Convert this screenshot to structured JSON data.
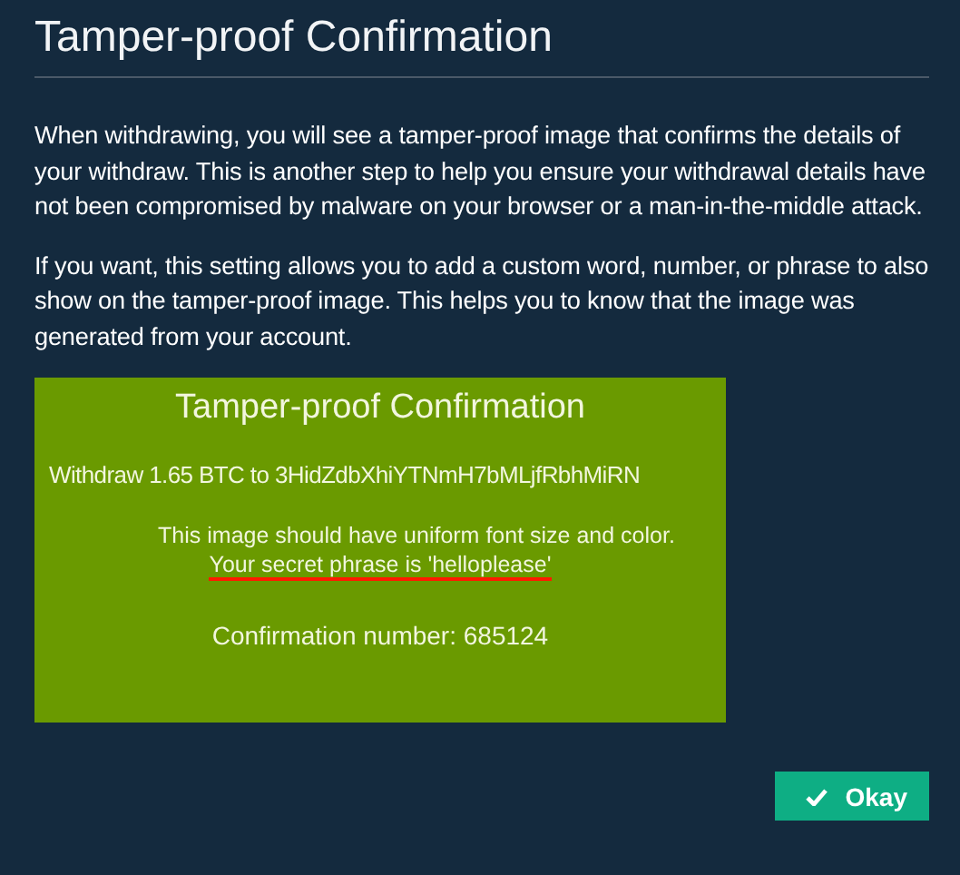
{
  "title": "Tamper-proof Confirmation",
  "paragraphs": [
    "When withdrawing, you will see a tamper-proof image that confirms the details of your withdraw. This is another step to help you ensure your withdrawal details have not been compromised by malware on your browser or a man-in-the-middle attack.",
    "If you want, this setting allows you to add a custom word, number, or phrase to also show on the tamper-proof image. This helps you to know that the image was generated from your account."
  ],
  "preview": {
    "title": "Tamper-proof Confirmation",
    "withdraw_line": "Withdraw 1.65 BTC to 3HidZdbXhiYTNmH7bMLjfRbhMiRN",
    "notice": "This image should have uniform font size and color.",
    "secret_line": "Your secret phrase is 'helloplease'",
    "secret_underlined": true,
    "confirmation": "Confirmation number: 685124"
  },
  "buttons": [
    {
      "label": "Okay",
      "kind": "confirm"
    }
  ]
}
